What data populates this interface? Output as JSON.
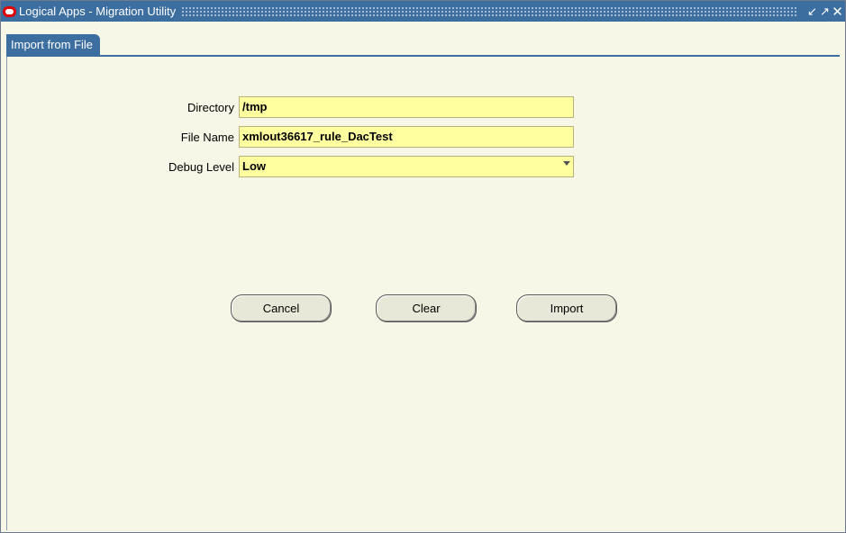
{
  "window": {
    "title": "Logical Apps - Migration Utility",
    "controls": [
      "restore-icon",
      "maximize-icon",
      "close-icon"
    ],
    "accent_color": "#3c6ea0",
    "field_color": "#ffffa0"
  },
  "tabs": [
    {
      "label": "Import from File",
      "active": true
    }
  ],
  "form": {
    "directory": {
      "label": "Directory",
      "value": "/tmp"
    },
    "file_name": {
      "label": "File Name",
      "value": "xmlout36617_rule_DacTest"
    },
    "debug_level": {
      "label": "Debug Level",
      "value": "Low"
    }
  },
  "buttons": {
    "cancel": "Cancel",
    "clear": "Clear",
    "import": "Import"
  }
}
